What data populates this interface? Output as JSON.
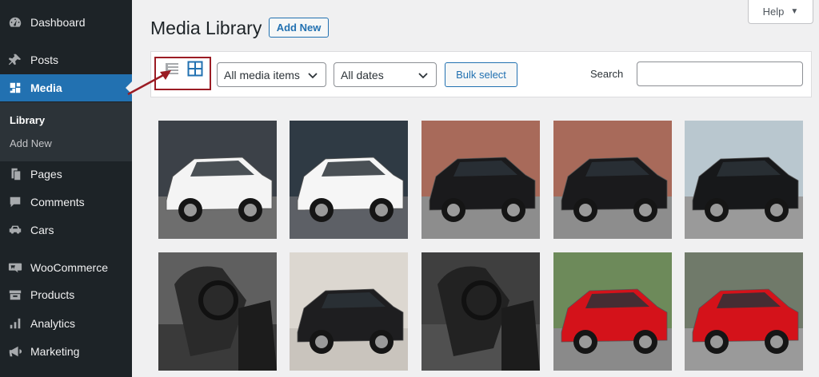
{
  "sidebar": {
    "items": [
      {
        "label": "Dashboard",
        "icon": "dashboard-icon"
      },
      {
        "label": "Posts",
        "icon": "pin-icon"
      },
      {
        "label": "Media",
        "icon": "media-icon",
        "active": true
      },
      {
        "label": "Pages",
        "icon": "pages-icon"
      },
      {
        "label": "Comments",
        "icon": "comments-icon"
      },
      {
        "label": "Cars",
        "icon": "car-icon"
      },
      {
        "label": "WooCommerce",
        "icon": "woocommerce-icon"
      },
      {
        "label": "Products",
        "icon": "products-icon"
      },
      {
        "label": "Analytics",
        "icon": "analytics-icon"
      },
      {
        "label": "Marketing",
        "icon": "marketing-icon"
      }
    ],
    "submenu": [
      {
        "label": "Library",
        "current": true
      },
      {
        "label": "Add New"
      }
    ]
  },
  "help": {
    "label": "Help"
  },
  "header": {
    "title": "Media Library",
    "add_new_label": "Add New"
  },
  "toolbar": {
    "filter_type": {
      "selected": "All media items"
    },
    "filter_date": {
      "selected": "All dates"
    },
    "bulk_select_label": "Bulk select",
    "search_label": "Search",
    "search_value": "",
    "list_view_icon": "list-view-icon",
    "grid_view_icon": "grid-view-icon",
    "grid_view_active": true
  },
  "colors": {
    "sidebar_bg": "#1d2327",
    "accent": "#2271b1",
    "highlight_box": "#9b1c24"
  },
  "media": [
    {
      "subject": "white Volkswagen up",
      "car": "#f4f4f4",
      "bg": "#3c4148",
      "ground": "#6e6e6e"
    },
    {
      "subject": "white Volkswagen Polo",
      "car": "#f6f6f6",
      "bg": "#2f3a44",
      "ground": "#5d6066"
    },
    {
      "subject": "black Volkswagen Polo",
      "car": "#1a1a1c",
      "bg": "#a86a5a",
      "ground": "#8d8d8d"
    },
    {
      "subject": "black Volkswagen Polo",
      "car": "#1a1a1c",
      "bg": "#a86a5a",
      "ground": "#8d8d8d"
    },
    {
      "subject": "black Volkswagen Scirocco",
      "car": "#17181a",
      "bg": "#b9c7cf",
      "ground": "#9a9a9a"
    },
    {
      "subject": "Volkswagen Scirocco interior",
      "car": "#2a2a2a",
      "bg": "#5f5f5f",
      "ground": "#3a3a3a"
    },
    {
      "subject": "black Volkswagen Golf",
      "car": "#1e1e20",
      "bg": "#dcd7d0",
      "ground": "#c9c4bd"
    },
    {
      "subject": "Volkswagen Scirocco seats",
      "car": "#222222",
      "bg": "#3f3f3f",
      "ground": "#505050"
    },
    {
      "subject": "red Volkswagen Polo",
      "car": "#d4121a",
      "bg": "#6d8a5a",
      "ground": "#8a8a8a"
    },
    {
      "subject": "red Volkswagen Polo",
      "car": "#d4121a",
      "bg": "#707a6a",
      "ground": "#9a9a9a"
    }
  ]
}
